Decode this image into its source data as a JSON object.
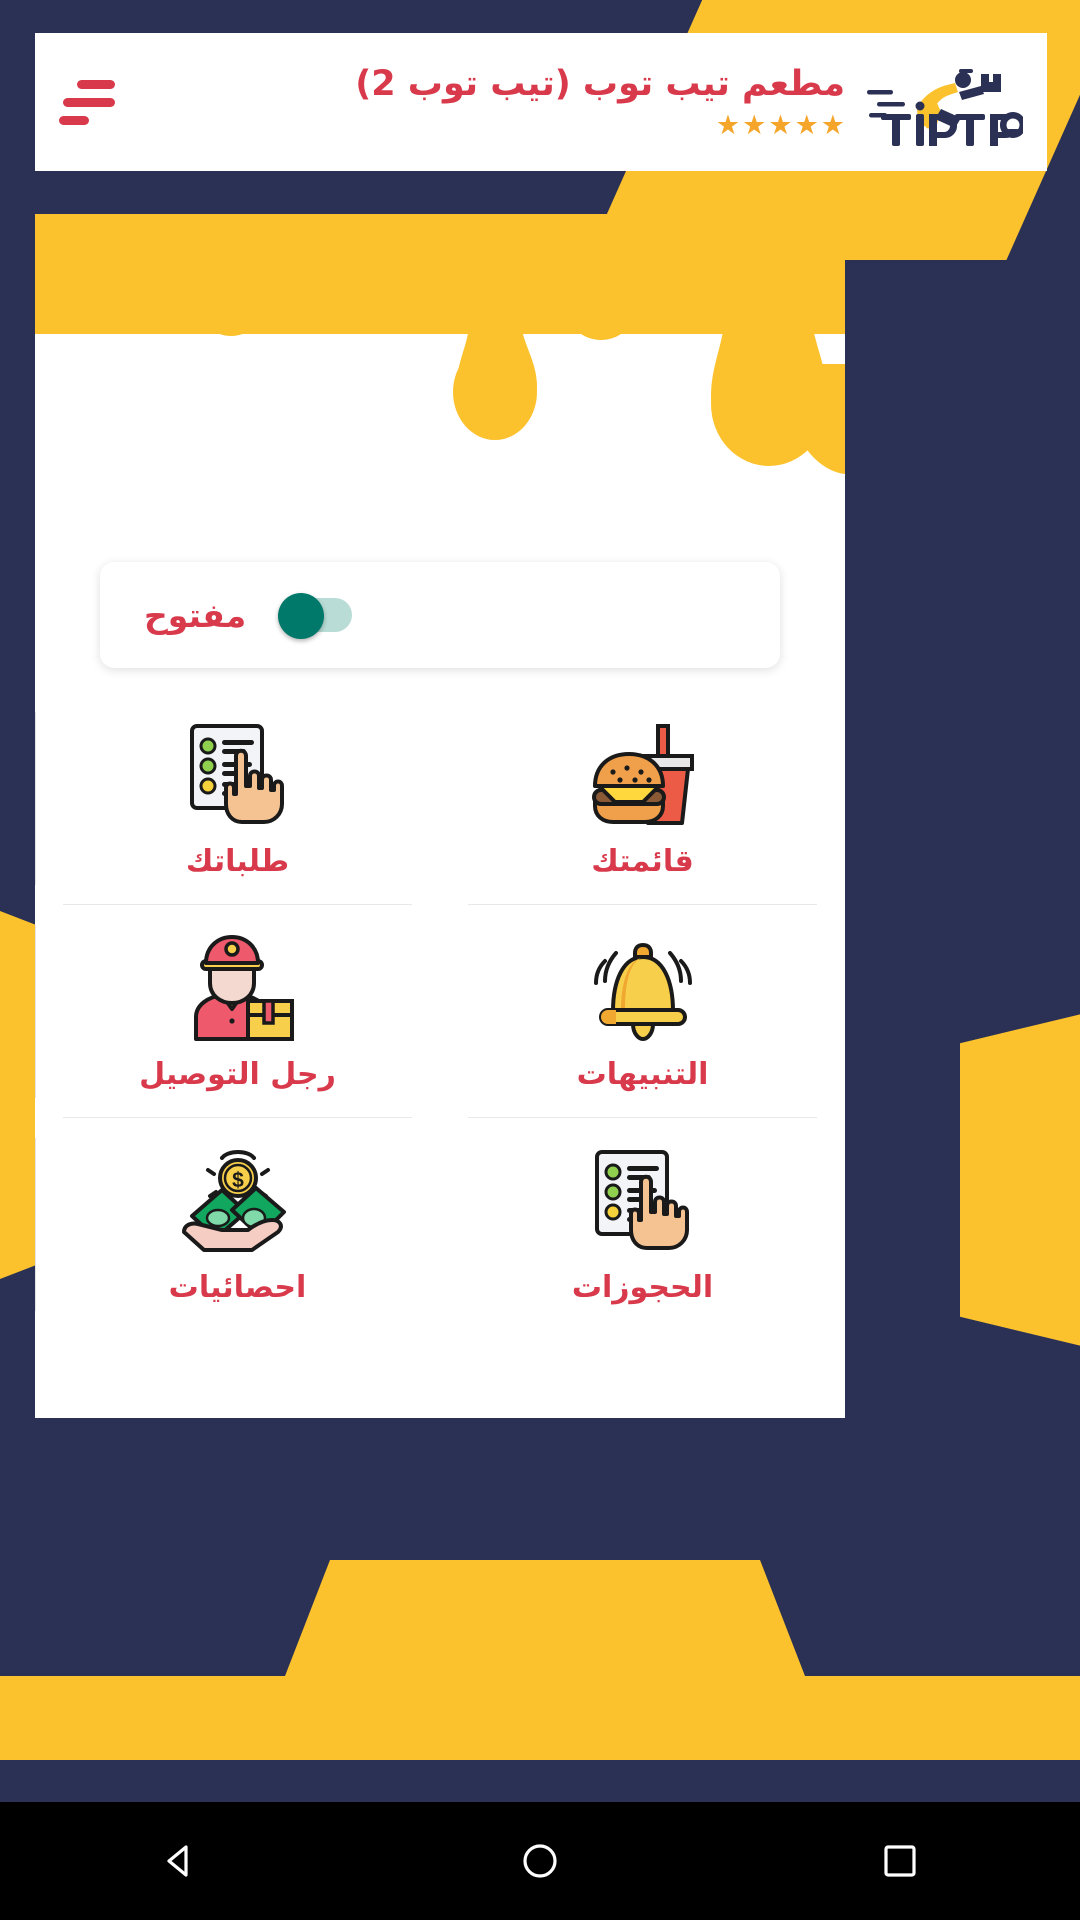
{
  "app": {
    "brand": "TIPTOP",
    "accent_red": "#d83a4b",
    "accent_yellow": "#fcc22e",
    "accent_navy": "#2b3154",
    "toggle_on_color": "#00786a",
    "star_color": "#f5a62a"
  },
  "header": {
    "menu_icon": "hamburger-menu-icon",
    "restaurant_name": "مطعم تيب توب (تيب توب 2)",
    "rating_stars": 5,
    "star_glyph": "★",
    "logo_text": "TIPTOP",
    "logo_icon": "delivery-runner-icon"
  },
  "banner": {
    "icon": "honey-drip-banner",
    "color": "#fcc22e"
  },
  "status_toggle": {
    "label": "مفتوح",
    "state": "on",
    "name": "store-open-toggle"
  },
  "grid": {
    "items": [
      {
        "id": "menu",
        "label": "قائمتك",
        "icon": "burger-and-drink-icon"
      },
      {
        "id": "orders",
        "label": "طلباتك",
        "icon": "checklist-hand-icon"
      },
      {
        "id": "alerts",
        "label": "التنبيهات",
        "icon": "ringing-bell-icon"
      },
      {
        "id": "delivery",
        "label": "رجل التوصيل",
        "icon": "delivery-man-icon"
      },
      {
        "id": "bookings",
        "label": "الحجوزات",
        "icon": "checklist-hand-icon"
      },
      {
        "id": "statistics",
        "label": "احصائيات",
        "icon": "money-in-hand-icon"
      }
    ]
  },
  "navbar": {
    "back": "back-triangle-icon",
    "home": "home-circle-icon",
    "recents": "recents-square-icon"
  }
}
